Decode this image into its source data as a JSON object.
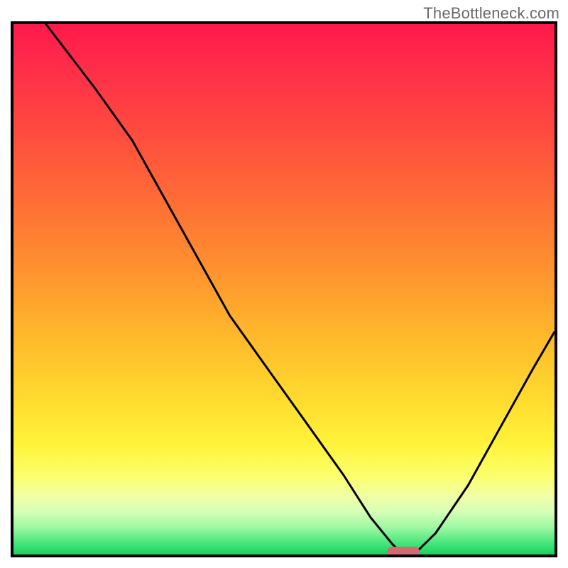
{
  "watermark": "TheBottleneck.com",
  "chart_data": {
    "type": "line",
    "title": "",
    "xlabel": "",
    "ylabel": "",
    "xlim": [
      0,
      100
    ],
    "ylim": [
      0,
      100
    ],
    "grid": false,
    "legend": false,
    "note": "Axes are unlabeled; values are normalized 0–100 estimated from pixel positions. Gradient background runs from high bottleneck (red, top) to low (green, bottom). Curve reaches minimum near x≈72.",
    "series": [
      {
        "name": "bottleneck-curve",
        "x": [
          6,
          15,
          22,
          28,
          34,
          40,
          47,
          54,
          61,
          66,
          70,
          72,
          74,
          78,
          84,
          90,
          96,
          100
        ],
        "y": [
          100,
          88,
          78,
          67,
          56,
          45,
          35,
          25,
          15,
          7,
          2,
          0,
          0,
          4,
          13,
          24,
          35,
          42
        ]
      }
    ],
    "marker": {
      "name": "target-pill",
      "x": 72,
      "y": 0,
      "color": "#d46a6f"
    },
    "gradient_stops": [
      {
        "pct": 0,
        "color": "#ff1a4b"
      },
      {
        "pct": 8,
        "color": "#ff2d49"
      },
      {
        "pct": 20,
        "color": "#ff4a3f"
      },
      {
        "pct": 32,
        "color": "#ff6a36"
      },
      {
        "pct": 45,
        "color": "#ff8e2f"
      },
      {
        "pct": 58,
        "color": "#ffb62b"
      },
      {
        "pct": 70,
        "color": "#ffd92e"
      },
      {
        "pct": 79,
        "color": "#fff23a"
      },
      {
        "pct": 85,
        "color": "#fcff6a"
      },
      {
        "pct": 89,
        "color": "#f1ffa5"
      },
      {
        "pct": 92,
        "color": "#d4ffb6"
      },
      {
        "pct": 95,
        "color": "#9cf7a1"
      },
      {
        "pct": 98,
        "color": "#42e57a"
      },
      {
        "pct": 100,
        "color": "#19d25c"
      }
    ]
  }
}
